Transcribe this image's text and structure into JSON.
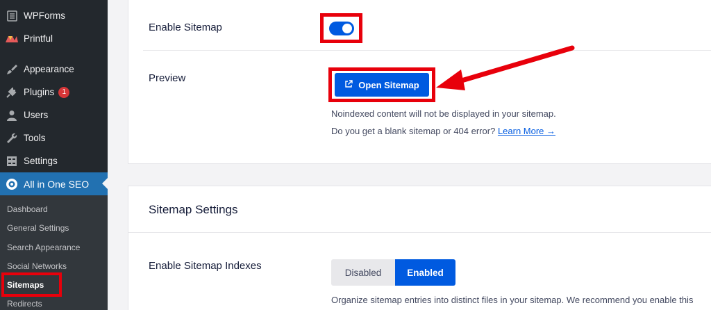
{
  "sidebar": {
    "items": [
      {
        "label": "WPForms",
        "icon": "wpforms-icon"
      },
      {
        "label": "Printful",
        "icon": "printful-icon"
      },
      {
        "label": "Appearance",
        "icon": "paintbrush-icon"
      },
      {
        "label": "Plugins",
        "icon": "plugin-icon",
        "badge": "1"
      },
      {
        "label": "Users",
        "icon": "user-icon"
      },
      {
        "label": "Tools",
        "icon": "wrench-icon"
      },
      {
        "label": "Settings",
        "icon": "settings-icon"
      },
      {
        "label": "All in One SEO",
        "icon": "aioseo-icon",
        "active": true
      }
    ],
    "submenu": [
      "Dashboard",
      "General Settings",
      "Search Appearance",
      "Social Networks",
      "Sitemaps",
      "Redirects"
    ]
  },
  "sitemap_card": {
    "enable_label": "Enable Sitemap",
    "enable_state": "on",
    "preview_label": "Preview",
    "open_button": "Open Sitemap",
    "note1": "Noindexed content will not be displayed in your sitemap.",
    "note2": "Do you get a blank sitemap or 404 error?",
    "learn_more": "Learn More →"
  },
  "settings_card": {
    "title": "Sitemap Settings",
    "indexes_label": "Enable Sitemap Indexes",
    "seg_disabled": "Disabled",
    "seg_enabled": "Enabled",
    "description": "Organize sitemap entries into distinct files in your sitemap. We recommend you enable this"
  },
  "colors": {
    "accent": "#005ae0",
    "highlight": "#e8000b",
    "sidebar_bg": "#23282d",
    "active_menu": "#2271b1"
  }
}
